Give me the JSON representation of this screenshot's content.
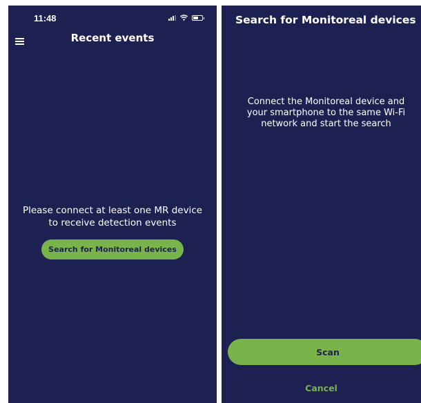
{
  "colors": {
    "background": "#1d2152",
    "accent": "#79b44a",
    "text": "#ffffff"
  },
  "left": {
    "status_bar": {
      "time": "11:48",
      "icons": [
        "signal-icon",
        "wifi-icon",
        "battery-icon"
      ]
    },
    "header": {
      "menu_icon": "menu-icon",
      "title": "Recent events"
    },
    "empty_state": {
      "line1": "Please connect at least one MR device",
      "line2": "to receive detection events",
      "button_label": "Search for Monitoreal devices"
    }
  },
  "right": {
    "title": "Search for Monitoreal devices",
    "instruction_lines": [
      "Connect the Monitoreal device and",
      "your smartphone to the same Wi-Fi",
      "network and start the search"
    ],
    "scan_label": "Scan",
    "cancel_label": "Cancel"
  }
}
